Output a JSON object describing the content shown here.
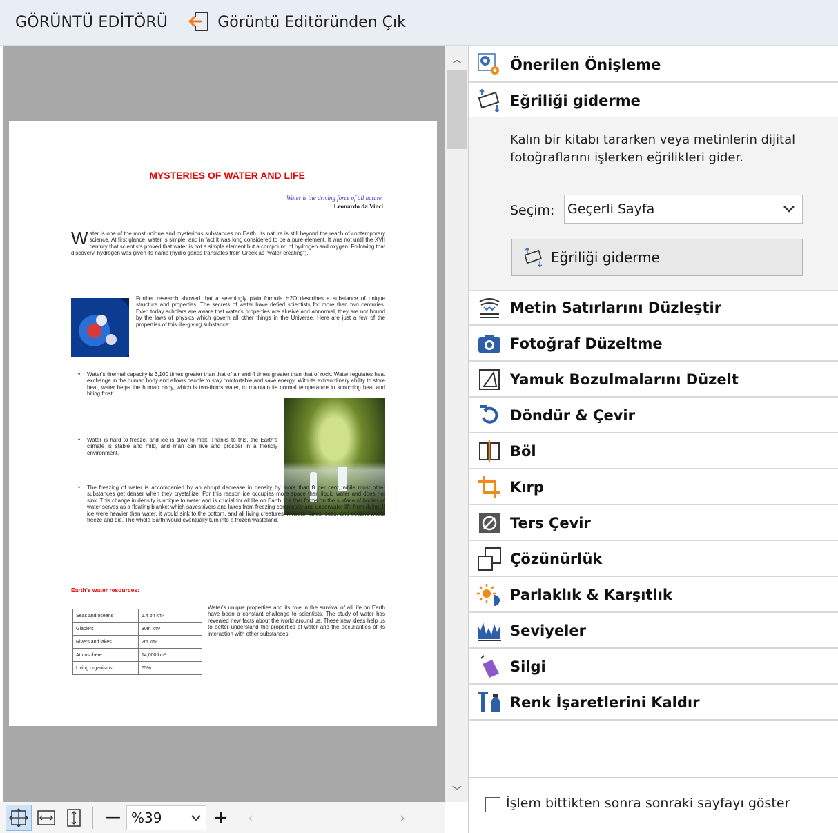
{
  "header": {
    "title": "GÖRÜNTÜ EDİTÖRÜ",
    "exit_label": "Görüntü Editöründen Çık"
  },
  "document": {
    "title": "MYSTERIES OF WATER AND LIFE",
    "quote": "Water is the driving force of all nature.",
    "author": "Leonardo da Vinci",
    "para1_dropcap": "W",
    "para1": "ater is one of the most unique and mysterious substances on Earth. Its nature is still beyond the reach of contemporary science. At first glance, water is simple, and in fact it was long considered to be a pure element. It was not until the XVII century that scientists proved that water is not a simple element but a compound of hydrogen and oxygen. Following that discovery, hydrogen was given its name (hydro genes translates from Greek as \"water-creating\").",
    "para2": "Further research showed that a seemingly plain formula H2O describes a substance of unique structure and properties. The secrets of water have defied scientists for more than two centuries. Even today scholars are aware that water's properties are elusive and abnormal, they are not bound by the laws of physics which govern all other things in the Universe. Here are just a few of the properties of this life-giving substance:",
    "bullet1": "Water's thermal capacity is 3,100 times greater than that of air and 4 times greater than that of rock. Water regulates heat exchange in the human body and allows people to stay comfortable and save energy. With its extraordinary ability to store heat, water helps the human body, which is two-thirds water, to maintain its normal temperature in scorching heat and biting frost.",
    "bullet2": "Water is hard to freeze, and ice is slow to melt. Thanks to this, the Earth's climate is stable and mild, and man can live and prosper in a friendly environment.",
    "bullet3": "The freezing of water is accompanied by an abrupt decrease in density by more than 8 per cent, while most other substances get denser when they crystallize. For this reason ice occupies more space than liquid water and does not sink. This change in density is unique to water and is crucial for all life on Earth. Ice that forms on the surface of bodies of water serves as a floating blanket which saves rivers and lakes from freezing completely and underwater life from dying. If ice were heavier than water, it would sink to the bottom, and all living creatures in rivers, lakes, seas, and oceans would freeze and die. The whole Earth would eventually turn into a frozen wasteland.",
    "resources_title": "Earth's water resources:",
    "table": [
      [
        "Seas and oceans",
        "1.4 bn km³"
      ],
      [
        "Glaciers",
        "30m km³"
      ],
      [
        "Rivers and lakes",
        "2m km³"
      ],
      [
        "Atmosphere",
        "14,000 km³"
      ],
      [
        "Living organisms",
        "65%"
      ]
    ],
    "para3": "Water's unique properties and its role in the survival of all life on Earth have been a constant challenge to scientists. The study of water has revealed new facts about the world around us. These new ideas help us to better understand the properties of water and the peculiarities of its interaction with other substances."
  },
  "toolbar": {
    "zoom_value": "%39",
    "minus": "—",
    "plus": "+"
  },
  "panel": {
    "tools_top": [
      {
        "name": "recommended-preprocessing",
        "label": "Önerilen Önişleme",
        "icon": "gear-icon"
      },
      {
        "name": "deskew",
        "label": "Eğriliği giderme",
        "icon": "deskew-icon"
      }
    ],
    "deskew_description": "Kalın bir kitabı tararken veya metinlerin dijital fotoğraflarını işlerken eğrilikleri gider.",
    "selection_label": "Seçim:",
    "selection_value": "Geçerli Sayfa",
    "deskew_button": "Eğriliği giderme",
    "tools": [
      {
        "name": "straighten-text-lines",
        "label": "Metin Satırlarını Düzleştir",
        "icon": "text-lines-icon"
      },
      {
        "name": "photo-correction",
        "label": "Fotoğraf Düzeltme",
        "icon": "camera-icon"
      },
      {
        "name": "trapezoid-correction",
        "label": "Yamuk Bozulmalarını Düzelt",
        "icon": "trapezoid-icon"
      },
      {
        "name": "rotate-flip",
        "label": "Döndür & Çevir",
        "icon": "rotate-icon"
      },
      {
        "name": "split",
        "label": "Böl",
        "icon": "split-icon"
      },
      {
        "name": "crop",
        "label": "Kırp",
        "icon": "crop-icon"
      },
      {
        "name": "invert",
        "label": "Ters Çevir",
        "icon": "invert-icon"
      },
      {
        "name": "resolution",
        "label": "Çözünürlük",
        "icon": "resolution-icon"
      },
      {
        "name": "brightness-contrast",
        "label": "Parlaklık & Karşıtlık",
        "icon": "brightness-icon"
      },
      {
        "name": "levels",
        "label": "Seviyeler",
        "icon": "levels-icon"
      },
      {
        "name": "eraser",
        "label": "Silgi",
        "icon": "eraser-icon"
      },
      {
        "name": "remove-color-marks",
        "label": "Renk İşaretlerini Kaldır",
        "icon": "color-marks-icon"
      }
    ],
    "show_next_page_label": "İşlem bittikten sonra sonraki sayfayı göster"
  }
}
